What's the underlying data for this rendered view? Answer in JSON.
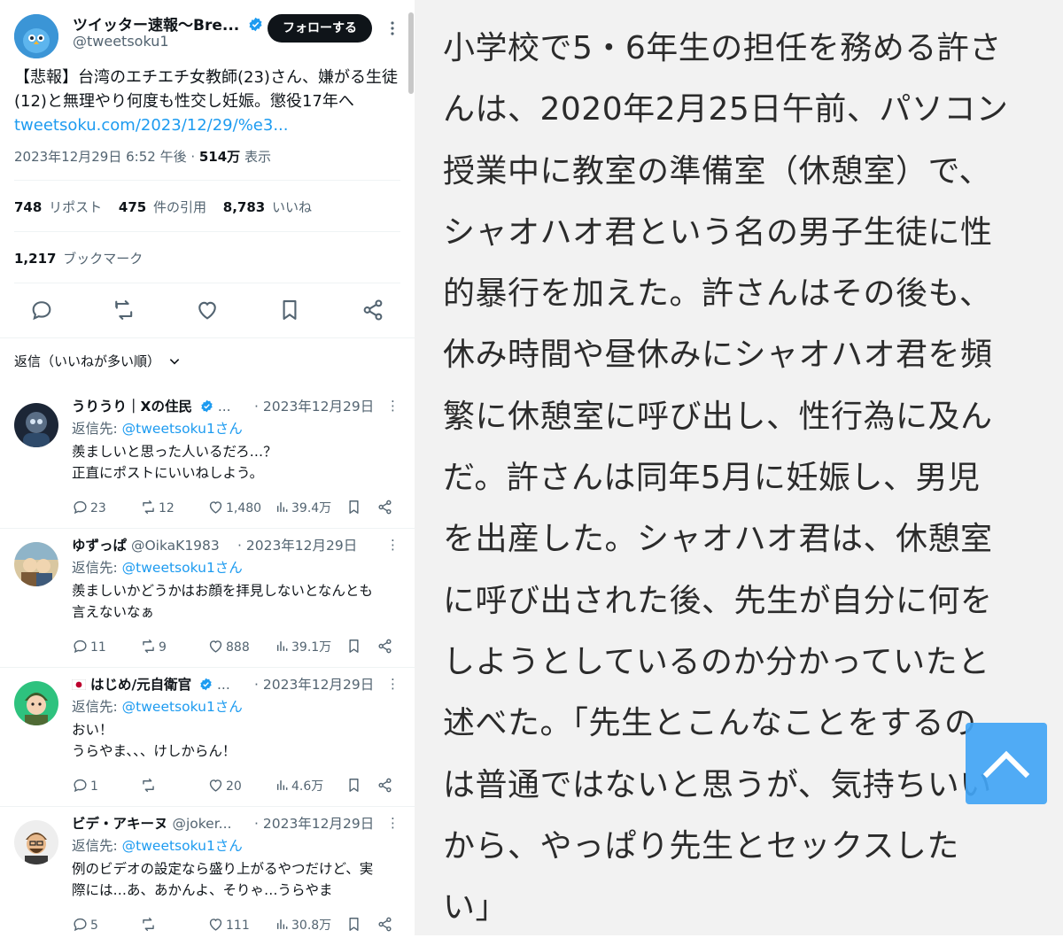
{
  "tweet": {
    "author_name": "ツイッター速報〜Bre...",
    "author_handle": "@tweetsoku1",
    "follow_label": "フォローする",
    "text": "【悲報】台湾のエチエチ女教師(23)さん、嫌がる生徒(12)と無理やり何度も性交し妊娠。懲役17年へ ",
    "link": "tweetsoku.com/2023/12/29/%e3...",
    "timestamp": "2023年12月29日 6:52 午後 · ",
    "views_count": "514万",
    "views_label": " 表示",
    "reposts_count": "748",
    "reposts_label": "リポスト",
    "quotes_count": "475",
    "quotes_label": "件の引用",
    "likes_count": "8,783",
    "likes_label": "いいね",
    "bookmarks_count": "1,217",
    "bookmarks_label": "ブックマーク"
  },
  "sort_label": "返信（いいねが多い順）",
  "replies": [
    {
      "name": "うりうり｜Xの住民",
      "handle": " ...",
      "date": "· 2023年12月29日",
      "reply_to_prefix": "返信先: ",
      "reply_to": "@tweetsoku1さん",
      "body_1": "羨ましいと思った人いるだろ…？",
      "body_2": "正直にポストにいいねしよう。",
      "replies": "23",
      "reposts": "12",
      "likes": "1,480",
      "views": "39.4万"
    },
    {
      "name": "ゆずっぱ",
      "handle": " @OikaK1983",
      "date": "· 2023年12月29日",
      "reply_to_prefix": "返信先: ",
      "reply_to": "@tweetsoku1さん",
      "body_1": "羨ましいかどうかはお顔を拝見しないとなんとも",
      "body_2": "言えないなぁ",
      "replies": "11",
      "reposts": "9",
      "likes": "888",
      "views": "39.1万"
    },
    {
      "name": "はじめ/元自衛官",
      "handle": " ...",
      "date": "· 2023年12月29日",
      "reply_to_prefix": "返信先: ",
      "reply_to": "@tweetsoku1さん",
      "body_1": "おい！",
      "body_2": "うらやま、、、けしからん！",
      "replies": "1",
      "reposts": "",
      "likes": "20",
      "views": "4.6万"
    },
    {
      "name": "ビデ・アキーヌ",
      "handle": " @joker...",
      "date": "· 2023年12月29日",
      "reply_to_prefix": "返信先: ",
      "reply_to": "@tweetsoku1さん",
      "body_1": "例のビデオの設定なら盛り上がるやつだけど、実",
      "body_2": "際には…あ、あかんよ、そりゃ…うらやま",
      "replies": "5",
      "reposts": "",
      "likes": "111",
      "views": "30.8万"
    }
  ],
  "article_lines": [
    "小学校で5・6年生の担任を務める許さ",
    "んは、2020年2月25日午前、パソコン",
    "授業中に教室の準備室（休憩室）で、",
    "シャオハオ君という名の男子生徒に性",
    "的暴行を加えた。許さんはその後も、",
    "休み時間や昼休みにシャオハオ君を頻",
    "繁に休憩室に呼び出し、性行為に及ん",
    "だ。許さんは同年5月に妊娠し、男児",
    "を出産した。シャオハオ君は、休憩室",
    "に呼び出された後、先生が自分に何を",
    "しようとしているのか分かっていたと",
    "述べた。「先生とこんなことをするの",
    "は普通ではないと思うが、気持ちいい",
    "から、やっぱり先生とセックスした",
    "い」"
  ],
  "colors": {
    "accent": "#1d9bf0",
    "text": "#0f1419",
    "muted": "#536471",
    "article_bg": "#f2f2f2",
    "scroll_button": "#42a5f5"
  },
  "icons": [
    "verified-badge-icon",
    "more-icon",
    "reply-icon",
    "repost-icon",
    "like-icon",
    "bookmark-icon",
    "share-icon",
    "chevron-down-icon",
    "views-icon",
    "chevron-up-icon"
  ]
}
